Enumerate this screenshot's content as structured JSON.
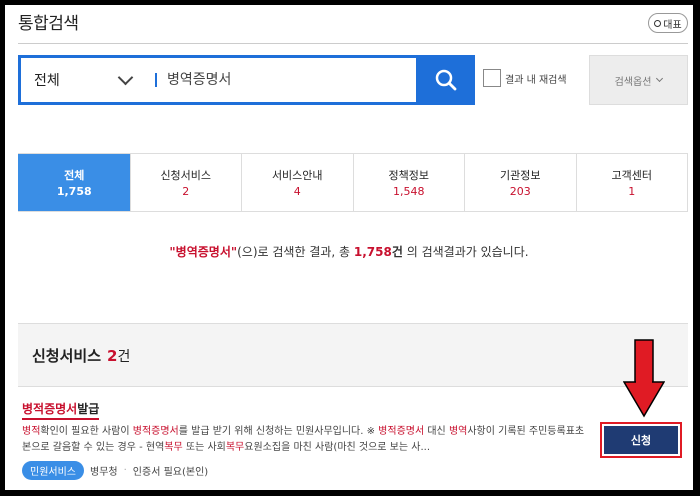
{
  "header": {
    "title": "통합검색",
    "rep_button_label": "대표"
  },
  "search": {
    "scope_value": "전체",
    "query_value": "병역증명서",
    "search_button_icon": "search-icon",
    "checkbox_label": "결과 내 재검색",
    "options_button_label": "검색옵션"
  },
  "tabs": [
    {
      "label": "전체",
      "count": "1,758",
      "active": true
    },
    {
      "label": "신청서비스",
      "count": "2",
      "active": false
    },
    {
      "label": "서비스안내",
      "count": "4",
      "active": false
    },
    {
      "label": "정책정보",
      "count": "1,548",
      "active": false
    },
    {
      "label": "기관정보",
      "count": "203",
      "active": false
    },
    {
      "label": "고객센터",
      "count": "1",
      "active": false
    }
  ],
  "summary": {
    "keyword": "\"병역증명서\"",
    "text1": "(으)로 검색한 결과, 총 ",
    "total": "1,758",
    "unit": "건",
    "text2": " 의 검색결과가 있습니다."
  },
  "section": {
    "title": "신청서비스",
    "count": "2",
    "unit": "건"
  },
  "result": {
    "title_hl": "병적증명서",
    "title_rest": "발급",
    "desc": [
      {
        "t": "병적",
        "hl": true
      },
      {
        "t": "확인이 필요한 사람이 ",
        "hl": false
      },
      {
        "t": "병적증명서",
        "hl": true
      },
      {
        "t": "를 발급 받기 위해 신청하는 민원사무입니다. ※ ",
        "hl": false
      },
      {
        "t": "병적증명서",
        "hl": true
      },
      {
        "t": " 대신 ",
        "hl": false
      },
      {
        "t": "병역",
        "hl": true
      },
      {
        "t": "사항이 기록된 주민등록표초본으로 갈음할 수 있는 경우 - 현역",
        "hl": false
      },
      {
        "t": "복무",
        "hl": true
      },
      {
        "t": " 또는 사회",
        "hl": false
      },
      {
        "t": "복무",
        "hl": true
      },
      {
        "t": "요원소집을 마친 사람(마친 것으로 보는 사...",
        "hl": false
      }
    ],
    "tag": "민원서비스",
    "agency": "병무청",
    "cert_note": "인증서 필요(본인)",
    "apply_label": "신청"
  },
  "colors": {
    "accent": "#1e6fd9",
    "tab_active": "#3a8ee6",
    "highlight": "#c8102e",
    "apply_bg": "#1f3b73",
    "arrow": "#e01b24"
  }
}
